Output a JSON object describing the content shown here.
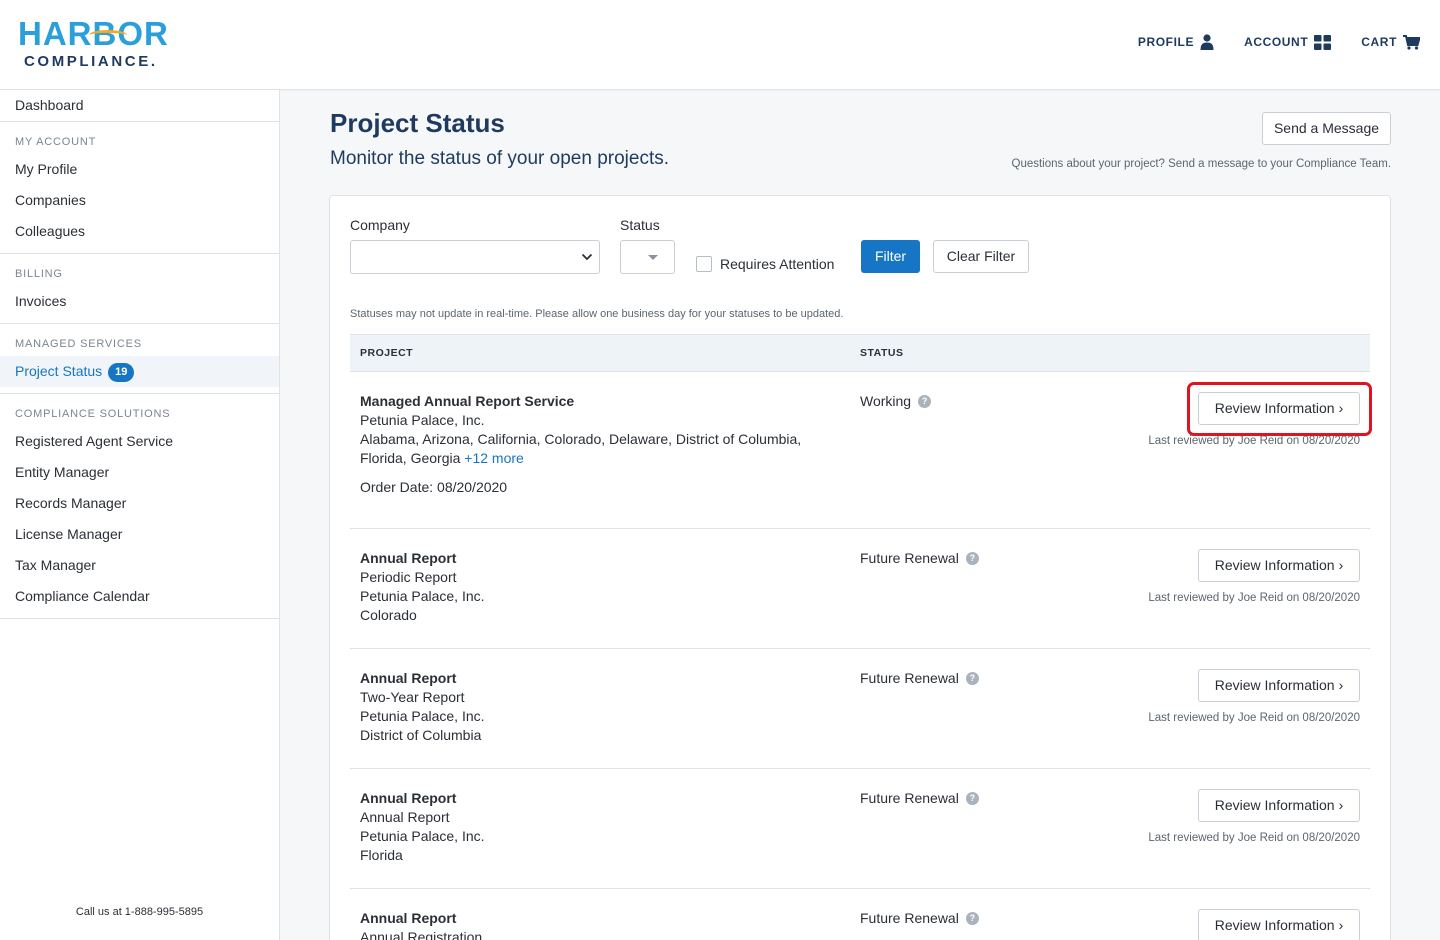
{
  "brand": {
    "line1": "HARBOR",
    "line2": "COMPLIANCE."
  },
  "topnav": [
    {
      "label": "PROFILE",
      "icon": "user-icon"
    },
    {
      "label": "ACCOUNT",
      "icon": "grid-icon"
    },
    {
      "label": "CART",
      "icon": "cart-icon"
    }
  ],
  "sidebar": {
    "dashboard": "Dashboard",
    "my_account": {
      "heading": "MY ACCOUNT",
      "items": [
        "My Profile",
        "Companies",
        "Colleagues"
      ]
    },
    "billing": {
      "heading": "BILLING",
      "items": [
        "Invoices"
      ]
    },
    "managed": {
      "heading": "MANAGED SERVICES",
      "item": "Project Status",
      "badge": "19"
    },
    "compliance": {
      "heading": "COMPLIANCE SOLUTIONS",
      "items": [
        "Registered Agent Service",
        "Entity Manager",
        "Records Manager",
        "License Manager",
        "Tax Manager",
        "Compliance Calendar"
      ]
    },
    "phone": "Call us at 1-888-995-5895"
  },
  "page": {
    "title": "Project Status",
    "subtitle": "Monitor the status of your open projects.",
    "message_button": "Send a Message",
    "message_note": "Questions about your project? Send a message to your Compliance Team."
  },
  "filters": {
    "company_label": "Company",
    "company_value": "",
    "status_label": "Status",
    "status_value": "",
    "requires_attention": "Requires Attention",
    "filter_button": "Filter",
    "clear_button": "Clear Filter"
  },
  "note": "Statuses may not update in real-time. Please allow one business day for your statuses to be updated.",
  "table": {
    "headers": [
      "PROJECT",
      "STATUS"
    ],
    "rows": [
      {
        "title": "Managed Annual Report Service",
        "lines": [
          "Petunia Palace, Inc.",
          "Alabama, Arizona, California, Colorado, Delaware, District of Columbia, Florida, Georgia"
        ],
        "more": "+12 more",
        "order": "Order Date: 08/20/2020",
        "status": "Working",
        "button": "Review Information",
        "reviewed": "Last reviewed by Joe Reid on 08/20/2020"
      },
      {
        "title": "Annual Report",
        "lines": [
          "Periodic Report",
          "Petunia Palace, Inc.",
          "Colorado"
        ],
        "status": "Future Renewal",
        "button": "Review Information",
        "reviewed": "Last reviewed by Joe Reid on 08/20/2020"
      },
      {
        "title": "Annual Report",
        "lines": [
          "Two-Year Report",
          "Petunia Palace, Inc.",
          "District of Columbia"
        ],
        "status": "Future Renewal",
        "button": "Review Information",
        "reviewed": "Last reviewed by Joe Reid on 08/20/2020"
      },
      {
        "title": "Annual Report",
        "lines": [
          "Annual Report",
          "Petunia Palace, Inc.",
          "Florida"
        ],
        "status": "Future Renewal",
        "button": "Review Information",
        "reviewed": "Last reviewed by Joe Reid on 08/20/2020"
      },
      {
        "title": "Annual Report",
        "lines": [
          "Annual Registration"
        ],
        "status": "Future Renewal",
        "button": "Review Information"
      }
    ]
  },
  "colors": {
    "brand_blue": "#1676c5",
    "navy": "#1f3a5f",
    "highlight": "#e0141e"
  }
}
